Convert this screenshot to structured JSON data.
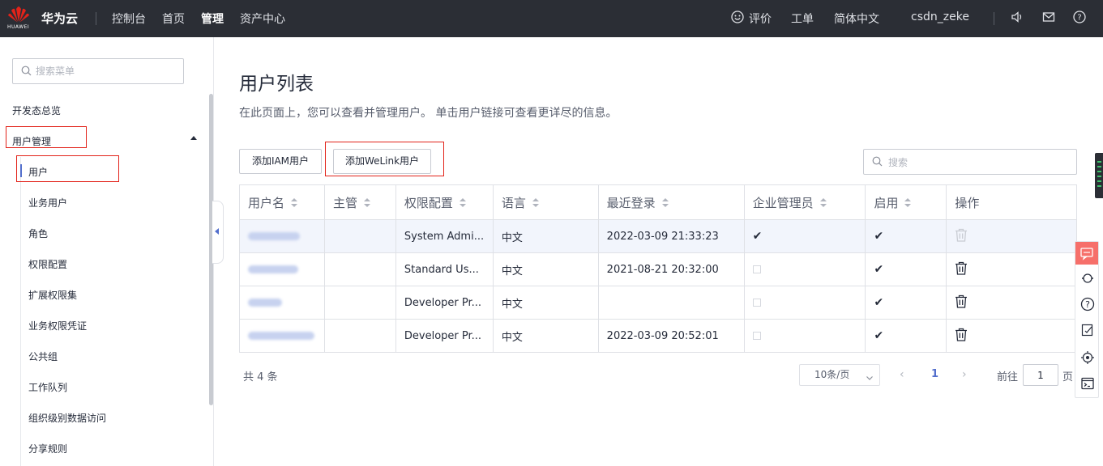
{
  "topbar": {
    "brand": "华为云",
    "logo_text": "HUAWEI",
    "nav": [
      "控制台",
      "首页",
      "管理",
      "资产中心"
    ],
    "active_nav": "管理",
    "feedback": "评价",
    "ticket": "工单",
    "language": "简体中文",
    "username": "csdn_zeke",
    "icons": [
      "smile-icon",
      "speaker-icon",
      "mail-icon",
      "help-icon"
    ]
  },
  "sidebar": {
    "search_placeholder": "搜索菜单",
    "overview": "开发态总览",
    "group": "用户管理",
    "items": [
      "用户",
      "业务用户",
      "角色",
      "权限配置",
      "扩展权限集",
      "业务权限凭证",
      "公共组",
      "工作队列",
      "组织级别数据访问",
      "分享规则"
    ],
    "active_item": "用户"
  },
  "main": {
    "title": "用户列表",
    "description": "在此页面上，您可以查看并管理用户。 单击用户链接可查看更详尽的信息。",
    "buttons": {
      "add_iam": "添加IAM用户",
      "add_welink": "添加WeLink用户"
    },
    "search_placeholder": "搜索"
  },
  "table": {
    "columns": [
      "用户名",
      "主管",
      "权限配置",
      "语言",
      "最近登录",
      "企业管理员",
      "启用",
      "操作"
    ],
    "rows": [
      {
        "manager": "",
        "permission": "System Admi...",
        "language": "中文",
        "last_login": "2022-03-09 21:33:23",
        "admin": true,
        "enabled": true
      },
      {
        "manager": "",
        "permission": "Standard Us...",
        "language": "中文",
        "last_login": "2021-08-21 20:32:00",
        "admin": false,
        "enabled": true
      },
      {
        "manager": "",
        "permission": "Developer Pr...",
        "language": "中文",
        "last_login": "",
        "admin": false,
        "enabled": true
      },
      {
        "manager": "",
        "permission": "Developer Pr...",
        "language": "中文",
        "last_login": "2022-03-09 20:52:01",
        "admin": false,
        "enabled": true
      }
    ]
  },
  "pagination": {
    "total": "共 4 条",
    "page_size": "10条/页",
    "current_page": "1",
    "goto_label": "前往",
    "goto_value": "1",
    "goto_suffix": "页"
  },
  "colors": {
    "accent": "#526ecc",
    "highlight_red": "#e2231a",
    "topbar": "#2b2e35"
  }
}
